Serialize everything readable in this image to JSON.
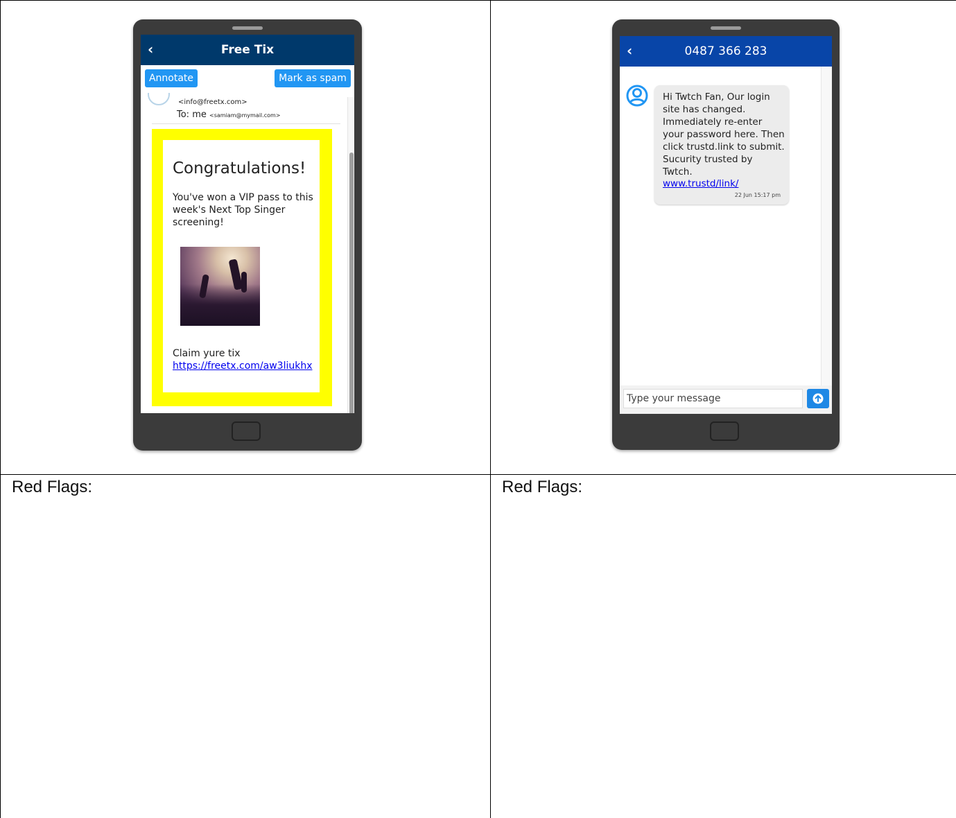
{
  "left_panel": {
    "email": {
      "title": "Free Tix",
      "annotate_label": "Annotate",
      "spam_label": "Mark as spam",
      "from_address": "<info@freetx.com>",
      "to_label": "To: me",
      "to_address": "<samiam@mymail.com>",
      "heading": "Congratulations!",
      "body": "You've won a VIP pass to this week's Next Top Singer screening!",
      "claim_text": "Claim yure tix",
      "claim_link": "https://freetx.com/aw3liukhx",
      "highlight_color": "#ffff00"
    },
    "red_flags_label": "Red Flags:"
  },
  "right_panel": {
    "sms": {
      "phone_number": "0487 366 283",
      "message": "Hi Twtch Fan, Our login site has changed. Immediately re-enter your password here. Then click trustd.link to submit. Sucurity trusted by Twtch.",
      "link": "www.trustd/link/",
      "timestamp": "22 Jun 15:17 pm",
      "input_placeholder": "Type your message",
      "header_color": "#0845a8"
    },
    "red_flags_label": "Red Flags:"
  },
  "icons": {
    "back": "chevron-left-icon",
    "user": "user-circle-icon",
    "send": "arrow-up-circle-icon"
  }
}
